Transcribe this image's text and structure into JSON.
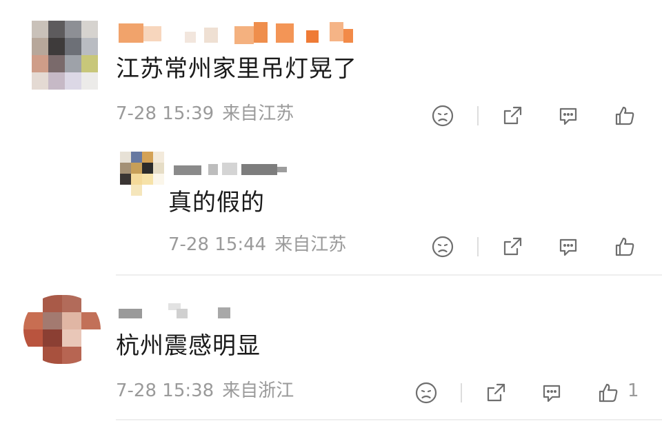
{
  "comments": [
    {
      "text": "江苏常州家里吊灯晃了",
      "date": "7-28 15:39",
      "location": "来自江苏",
      "like_count": ""
    },
    {
      "text": "真的假的",
      "date": "7-28 15:44",
      "location": "来自江苏",
      "like_count": ""
    },
    {
      "text": "杭州震感明显",
      "date": "7-28 15:38",
      "location": "来自浙江",
      "like_count": "1"
    }
  ],
  "icons": {
    "sad": "sad-face-icon",
    "share": "share-icon",
    "comment": "comment-icon",
    "like": "thumbs-up-icon"
  },
  "colors": {
    "text": "#1b1b1b",
    "meta": "#9a9a9a",
    "icon": "#6e6e6e",
    "divider": "#eeeeee"
  }
}
